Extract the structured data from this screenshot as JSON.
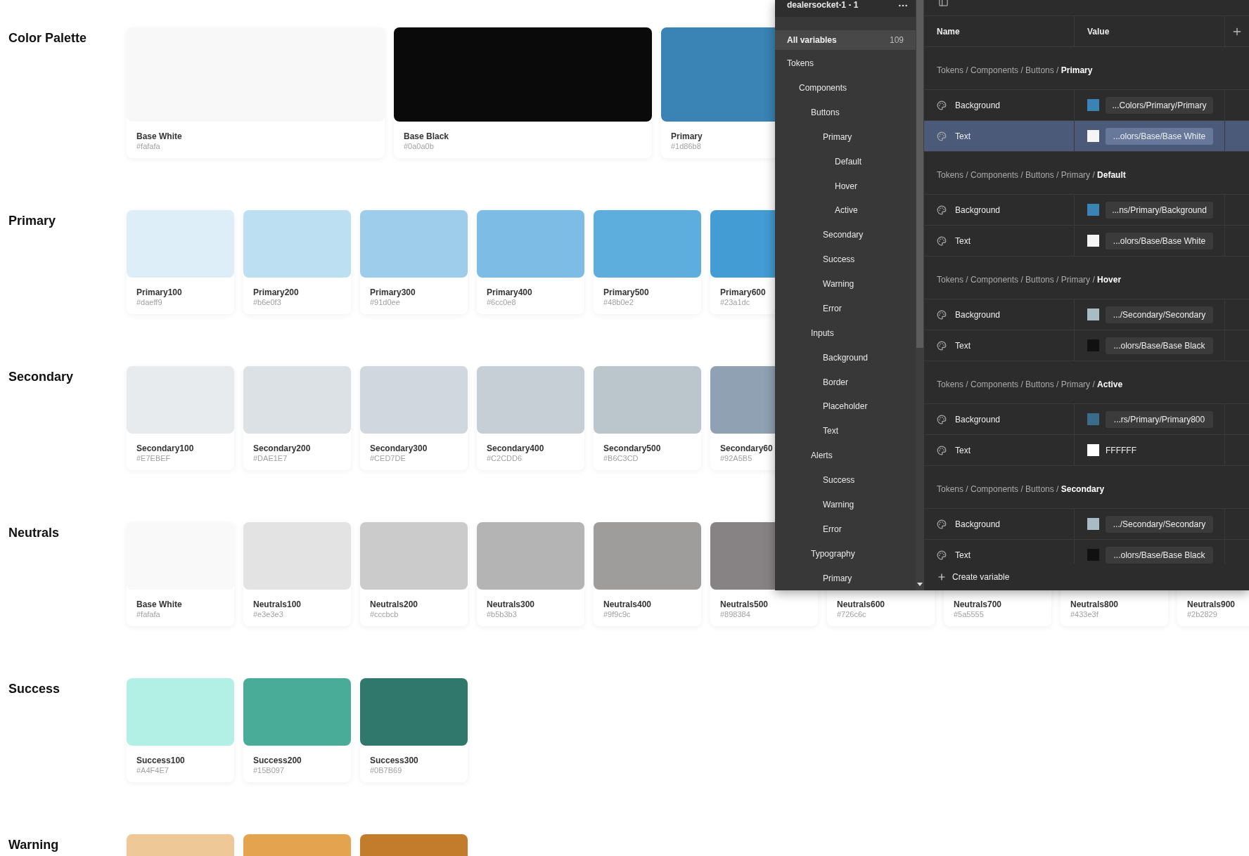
{
  "canvas": {
    "sections": [
      {
        "title": "Color Palette",
        "kind": "wide",
        "swatches": [
          {
            "name": "Base White",
            "hex": "#fafafa",
            "color": "#f8f8f8"
          },
          {
            "name": "Base Black",
            "hex": "#0a0a0b",
            "color": "#0a0a0b"
          },
          {
            "name": "Primary",
            "hex": "#1d86b8",
            "color": "#3a83b5"
          }
        ]
      },
      {
        "title": "Primary",
        "kind": "regular",
        "swatches": [
          {
            "name": "Primary100",
            "hex": "#daeff9",
            "color": "#ddeef8"
          },
          {
            "name": "Primary200",
            "hex": "#b6e0f3",
            "color": "#bcdff1"
          },
          {
            "name": "Primary300",
            "hex": "#91d0ee",
            "color": "#9dcdea"
          },
          {
            "name": "Primary400",
            "hex": "#6cc0e8",
            "color": "#7dbde5"
          },
          {
            "name": "Primary500",
            "hex": "#48b0e2",
            "color": "#5daedd"
          },
          {
            "name": "Primary600",
            "hex": "#23a1dc",
            "color": "#439cd3"
          }
        ]
      },
      {
        "title": "Secondary",
        "kind": "regular",
        "swatches": [
          {
            "name": "Secondary100",
            "hex": "#E7EBEF",
            "color": "#e7ebee"
          },
          {
            "name": "Secondary200",
            "hex": "#DAE1E7",
            "color": "#dce1e5"
          },
          {
            "name": "Secondary300",
            "hex": "#CED7DE",
            "color": "#d1d7de"
          },
          {
            "name": "Secondary400",
            "hex": "#C2CDD6",
            "color": "#c6ced6"
          },
          {
            "name": "Secondary500",
            "hex": "#B6C3CD",
            "color": "#bac5cc"
          },
          {
            "name": "Secondary60",
            "hex": "#92A5B5",
            "color": "#8fa1b2"
          }
        ]
      },
      {
        "title": "Neutrals",
        "kind": "regular",
        "swatches": [
          {
            "name": "Base White",
            "hex": "#fafafa",
            "color": "#f9f9f9"
          },
          {
            "name": "Neutrals100",
            "hex": "#e3e3e3",
            "color": "#e3e3e4"
          },
          {
            "name": "Neutrals200",
            "hex": "#cccbcb",
            "color": "#cbcbcb"
          },
          {
            "name": "Neutrals300",
            "hex": "#b5b3b3",
            "color": "#b5b4b4"
          },
          {
            "name": "Neutrals400",
            "hex": "#9f9c9c",
            "color": "#9f9c9c"
          },
          {
            "name": "Neutrals500",
            "hex": "#898384",
            "color": "#878283"
          },
          {
            "name": "Neutrals600",
            "hex": "#726c6c"
          },
          {
            "name": "Neutrals700",
            "hex": "#5a5555"
          },
          {
            "name": "Neutrals800",
            "hex": "#433e3f"
          },
          {
            "name": "Neutrals900",
            "hex": "#2b2829"
          }
        ]
      },
      {
        "title": "Success",
        "kind": "regular",
        "swatches": [
          {
            "name": "Success100",
            "hex": "#A4F4E7",
            "color": "#b2f0e6"
          },
          {
            "name": "Success200",
            "hex": "#15B097",
            "color": "#48ac98"
          },
          {
            "name": "Success300",
            "hex": "#0B7B69",
            "color": "#2f786b"
          }
        ]
      },
      {
        "title": "Warning",
        "kind": "regular",
        "swatches": [
          {
            "color": "#eec896"
          },
          {
            "color": "#e3a34f"
          },
          {
            "color": "#c27c2c"
          }
        ]
      }
    ]
  },
  "variables_panel": {
    "file_name": "dealersocket-1 - 1",
    "all_variables": {
      "label": "All variables",
      "count": "109",
      "selected": true
    },
    "tree": [
      {
        "label": "Tokens",
        "children": [
          {
            "label": "Components",
            "children": [
              {
                "label": "Buttons",
                "children": [
                  {
                    "label": "Primary",
                    "children": [
                      {
                        "label": "Default"
                      },
                      {
                        "label": "Hover"
                      },
                      {
                        "label": "Active"
                      }
                    ]
                  },
                  {
                    "label": "Secondary"
                  },
                  {
                    "label": "Success"
                  },
                  {
                    "label": "Warning"
                  },
                  {
                    "label": "Error"
                  }
                ]
              },
              {
                "label": "Inputs",
                "children": [
                  {
                    "label": "Background"
                  },
                  {
                    "label": "Border"
                  },
                  {
                    "label": "Placeholder"
                  },
                  {
                    "label": "Text"
                  }
                ]
              },
              {
                "label": "Alerts",
                "children": [
                  {
                    "label": "Success"
                  },
                  {
                    "label": "Warning"
                  },
                  {
                    "label": "Error"
                  }
                ]
              },
              {
                "label": "Typography",
                "children": [
                  {
                    "label": "Primary"
                  }
                ]
              }
            ]
          }
        ]
      }
    ],
    "columns": [
      "Name",
      "Value"
    ],
    "groups": [
      {
        "path": "Tokens / Components / Buttons / **Primary**",
        "rows": [
          {
            "name": "Background",
            "kind": "alias",
            "color": "#3a83b5",
            "value": "...Colors/Primary/Primary",
            "selected": false
          },
          {
            "name": "Text",
            "kind": "alias",
            "color": "#f5f5f5",
            "value": "...olors/Base/Base White",
            "selected": true
          }
        ]
      },
      {
        "path": "Tokens / Components / Buttons / Primary / **Default**",
        "rows": [
          {
            "name": "Background",
            "kind": "alias",
            "color": "#3a83b5",
            "value": "...ns/Primary/Background",
            "selected": false
          },
          {
            "name": "Text",
            "kind": "alias",
            "color": "#f5f5f5",
            "value": "...olors/Base/Base White",
            "selected": false
          }
        ]
      },
      {
        "path": "Tokens / Components / Buttons / Primary / **Hover**",
        "rows": [
          {
            "name": "Background",
            "kind": "alias",
            "color": "#a9bcc3",
            "value": ".../Secondary/Secondary",
            "selected": false
          },
          {
            "name": "Text",
            "kind": "alias",
            "color": "#111111",
            "value": "...olors/Base/Base Black",
            "selected": false
          }
        ]
      },
      {
        "path": "Tokens / Components / Buttons / Primary / **Active**",
        "rows": [
          {
            "name": "Background",
            "kind": "alias",
            "color": "#3b6b8a",
            "value": "...rs/Primary/Primary800",
            "selected": false
          },
          {
            "name": "Text",
            "kind": "raw",
            "color": "#ffffff",
            "value": "FFFFFF",
            "selected": false
          }
        ]
      },
      {
        "path": "Tokens / Components / Buttons / **Secondary**",
        "rows": [
          {
            "name": "Background",
            "kind": "alias",
            "color": "#a9bcc3",
            "value": ".../Secondary/Secondary",
            "selected": false
          },
          {
            "name": "Text",
            "kind": "alias",
            "color": "#111111",
            "value": "...olors/Base/Base Black",
            "selected": false
          }
        ]
      }
    ],
    "create_label": "Create variable"
  }
}
